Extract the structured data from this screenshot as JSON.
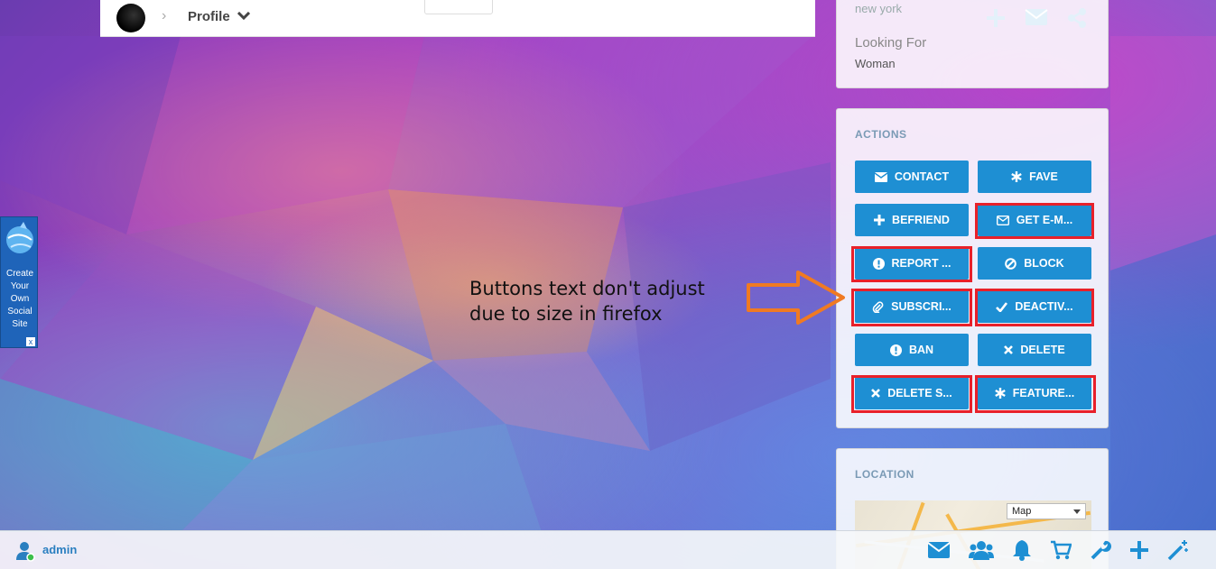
{
  "topbar": {
    "profile_label": "Profile"
  },
  "info": {
    "location": "new york",
    "looking_for_label": "Looking For",
    "looking_for_value": "Woman"
  },
  "actions": {
    "title": "ACTIONS",
    "buttons": [
      {
        "label": "CONTACT",
        "icon": "envelope-icon"
      },
      {
        "label": "FAVE",
        "icon": "asterisk-icon"
      },
      {
        "label": "BEFRIEND",
        "icon": "plus-icon"
      },
      {
        "label": "GET E-M...",
        "icon": "envelope-outline-icon"
      },
      {
        "label": "REPORT ...",
        "icon": "exclamation-icon"
      },
      {
        "label": "BLOCK",
        "icon": "ban-icon"
      },
      {
        "label": "SUBSCRI...",
        "icon": "paperclip-icon"
      },
      {
        "label": "DEACTIV...",
        "icon": "check-icon"
      },
      {
        "label": "BAN",
        "icon": "exclamation-icon"
      },
      {
        "label": "DELETE",
        "icon": "x-icon"
      },
      {
        "label": "DELETE S...",
        "icon": "x-icon"
      },
      {
        "label": "FEATURE...",
        "icon": "asterisk-icon"
      }
    ]
  },
  "location": {
    "title": "LOCATION",
    "map_type": "Map"
  },
  "side_widget": {
    "lines": [
      "Create",
      "Your",
      "Own",
      "Social",
      "Site"
    ],
    "close": "x"
  },
  "annotation": {
    "line1": "Buttons text don't adjust",
    "line2": "due to size in firefox"
  },
  "bottombar": {
    "username": "admin"
  },
  "colors": {
    "accent": "#1e8fd3",
    "highlight": "#e8202a",
    "arrow": "#f07a22"
  }
}
